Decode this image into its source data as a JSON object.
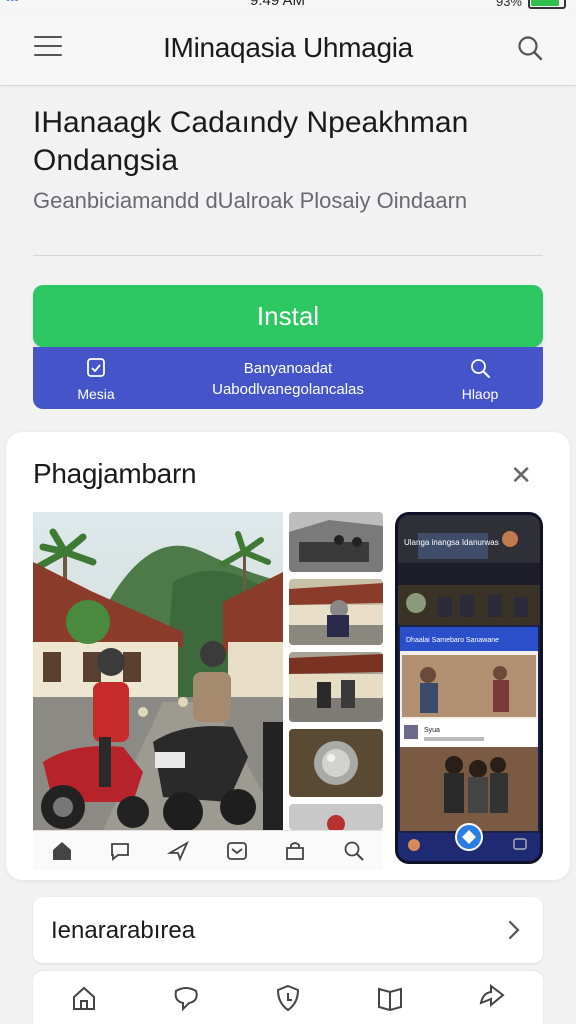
{
  "status_bar": {
    "time": "9:49 AM",
    "left": "•••",
    "battery": "93%"
  },
  "header": {
    "title": "IMinaqasia Uhmagia",
    "menu_icon": "hamburger-icon",
    "search_icon": "search-icon"
  },
  "app": {
    "title": "IHanaagk Cadaındy Npeakhman Ondangsia",
    "subtitle": "Geanbiciamandd dUalroak Plosaiy Oindaarn"
  },
  "install_button": {
    "label": "Instal"
  },
  "action_bar": {
    "left_label": "Mesia",
    "left_icon": "badge-icon",
    "center_line1": "Banyanoadat",
    "center_line2": "Uabodlvanegolancalas",
    "right_label": "Hlaop",
    "right_icon": "search-icon"
  },
  "gallery": {
    "title": "Phagjambarn",
    "close_icon": "close-icon",
    "nav_icons": [
      "home-icon",
      "chat-icon",
      "send-icon",
      "mail-icon",
      "bag-icon",
      "search-icon"
    ],
    "phone": {
      "caption": "Ulanga inangsa Idanurwas",
      "post_label": "Dhaalai Samebaro Sanawane",
      "list_label": "Syua"
    }
  },
  "list_row": {
    "label": "Ienararabırea",
    "chevron_icon": "chevron-right-icon"
  },
  "bottom_nav": {
    "icons": [
      "home-icon",
      "chat-icon",
      "shield-icon",
      "book-icon",
      "share-icon"
    ]
  },
  "colors": {
    "install": "#2ec862",
    "action_bar": "#4555c9",
    "background": "#f2f2f3"
  }
}
